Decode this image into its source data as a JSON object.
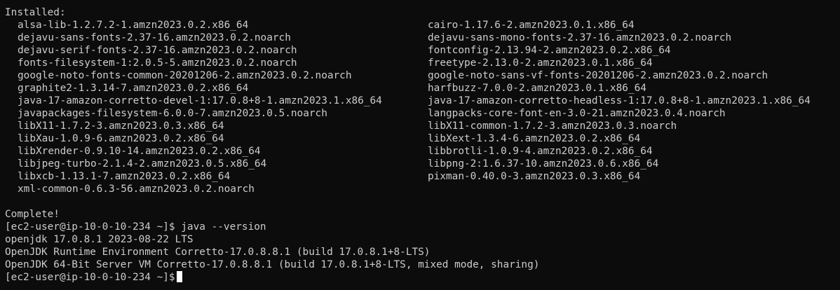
{
  "terminal": {
    "installed_header": "Installed:",
    "packages": [
      [
        "alsa-lib-1.2.7.2-1.amzn2023.0.2.x86_64",
        "cairo-1.17.6-2.amzn2023.0.1.x86_64"
      ],
      [
        "dejavu-sans-fonts-2.37-16.amzn2023.0.2.noarch",
        "dejavu-sans-mono-fonts-2.37-16.amzn2023.0.2.noarch"
      ],
      [
        "dejavu-serif-fonts-2.37-16.amzn2023.0.2.noarch",
        "fontconfig-2.13.94-2.amzn2023.0.2.x86_64"
      ],
      [
        "fonts-filesystem-1:2.0.5-5.amzn2023.0.2.noarch",
        "freetype-2.13.0-2.amzn2023.0.1.x86_64"
      ],
      [
        "google-noto-fonts-common-20201206-2.amzn2023.0.2.noarch",
        "google-noto-sans-vf-fonts-20201206-2.amzn2023.0.2.noarch"
      ],
      [
        "graphite2-1.3.14-7.amzn2023.0.2.x86_64",
        "harfbuzz-7.0.0-2.amzn2023.0.1.x86_64"
      ],
      [
        "java-17-amazon-corretto-devel-1:17.0.8+8-1.amzn2023.1.x86_64",
        "java-17-amazon-corretto-headless-1:17.0.8+8-1.amzn2023.1.x86_64"
      ],
      [
        "javapackages-filesystem-6.0.0-7.amzn2023.0.5.noarch",
        "langpacks-core-font-en-3.0-21.amzn2023.0.4.noarch"
      ],
      [
        "libX11-1.7.2-3.amzn2023.0.3.x86_64",
        "libX11-common-1.7.2-3.amzn2023.0.3.noarch"
      ],
      [
        "libXau-1.0.9-6.amzn2023.0.2.x86_64",
        "libXext-1.3.4-6.amzn2023.0.2.x86_64"
      ],
      [
        "libXrender-0.9.10-14.amzn2023.0.2.x86_64",
        "libbrotli-1.0.9-4.amzn2023.0.2.x86_64"
      ],
      [
        "libjpeg-turbo-2.1.4-2.amzn2023.0.5.x86_64",
        "libpng-2:1.6.37-10.amzn2023.0.6.x86_64"
      ],
      [
        "libxcb-1.13.1-7.amzn2023.0.2.x86_64",
        "pixman-0.40.0-3.amzn2023.0.3.x86_64"
      ],
      [
        "xml-common-0.6.3-56.amzn2023.0.2.noarch",
        ""
      ]
    ],
    "complete_text": "Complete!",
    "prompt": "[ec2-user@ip-10-0-10-234 ~]$ ",
    "command": "java --version",
    "output": [
      "openjdk 17.0.8.1 2023-08-22 LTS",
      "OpenJDK Runtime Environment Corretto-17.0.8.8.1 (build 17.0.8.1+8-LTS)",
      "OpenJDK 64-Bit Server VM Corretto-17.0.8.8.1 (build 17.0.8.1+8-LTS, mixed mode, sharing)"
    ],
    "final_prompt": "[ec2-user@ip-10-0-10-234 ~]$"
  },
  "colors": {
    "background": "#0c0c0c",
    "foreground": "#cccccc",
    "cursor": "#ffffff"
  }
}
